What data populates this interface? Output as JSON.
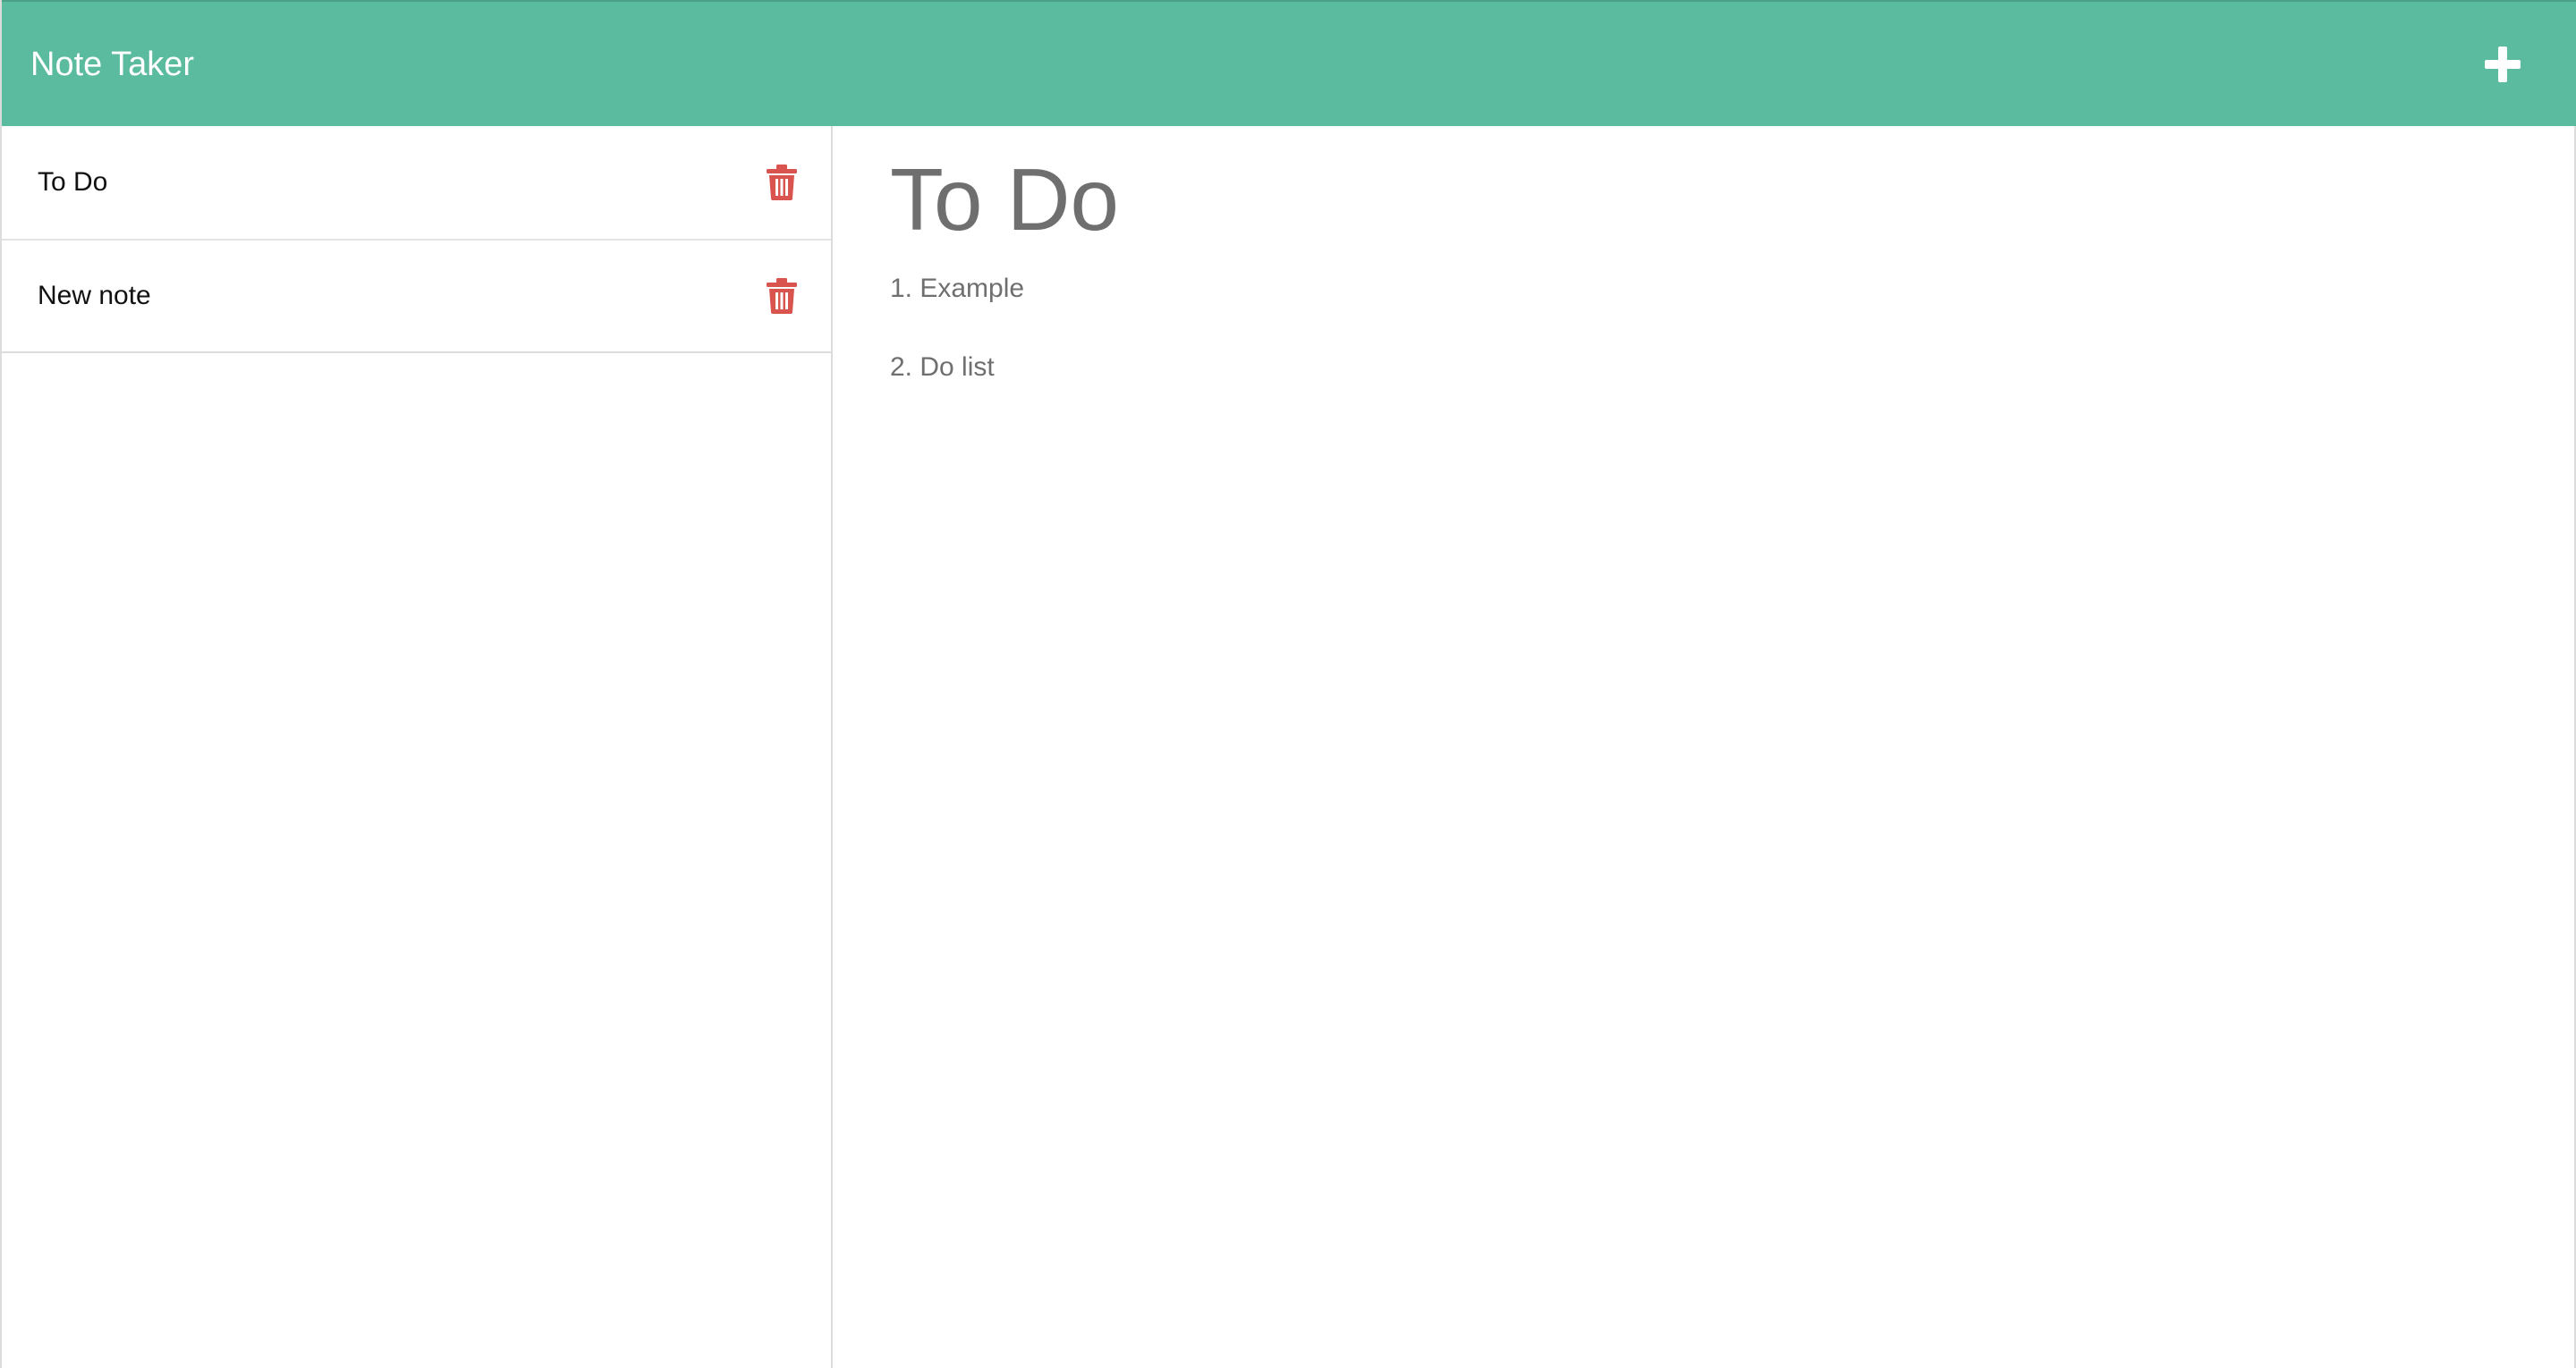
{
  "app": {
    "brand": "Note Taker"
  },
  "navbar": {
    "new_note_icon": "plus-icon"
  },
  "sidebar": {
    "notes": [
      {
        "title": "To Do",
        "delete_icon": "trash-icon"
      },
      {
        "title": "New note",
        "delete_icon": "trash-icon"
      }
    ]
  },
  "main": {
    "title": "To Do",
    "lines": [
      "1. Example",
      "2. Do list"
    ]
  },
  "colors": {
    "navbar": "#5bbb9f",
    "delete": "#d9534f",
    "text_muted": "#6f6f6f"
  }
}
